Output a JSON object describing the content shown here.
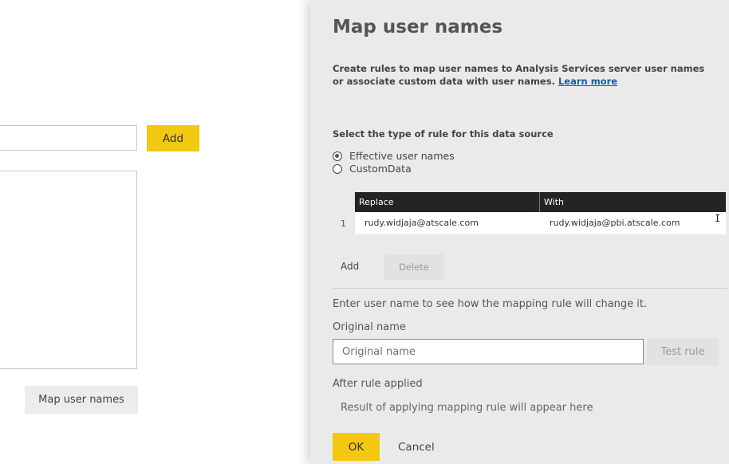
{
  "background": {
    "add_label": "Add",
    "map_user_names_label": "Map user names"
  },
  "panel": {
    "title": "Map user names",
    "description": "Create rules to map user names to Analysis Services server user names or associate custom data with user names.",
    "learn_more": "Learn more",
    "rule_type_label": "Select the type of rule for this data source",
    "rule_options": [
      {
        "label": "Effective user names",
        "selected": true
      },
      {
        "label": "CustomData",
        "selected": false
      }
    ],
    "table": {
      "headers": [
        "Replace",
        "With"
      ],
      "rows": [
        {
          "num": "1",
          "replace": "rudy.widjaja@atscale.com",
          "with": "rudy.widjaja@pbi.atscale.com"
        }
      ]
    },
    "add_label": "Add",
    "delete_label": "Delete",
    "enter_hint": "Enter user name to see how the mapping rule will change it.",
    "original_name_label": "Original name",
    "original_name_placeholder": "Original name",
    "test_rule_label": "Test rule",
    "after_rule_label": "After rule applied",
    "result_placeholder": "Result of applying mapping rule will appear here",
    "ok_label": "OK",
    "cancel_label": "Cancel"
  },
  "colors": {
    "accent": "#f2c811",
    "panel_bg": "#eaeaea",
    "table_header": "#252423",
    "link": "#0f5ea8"
  }
}
